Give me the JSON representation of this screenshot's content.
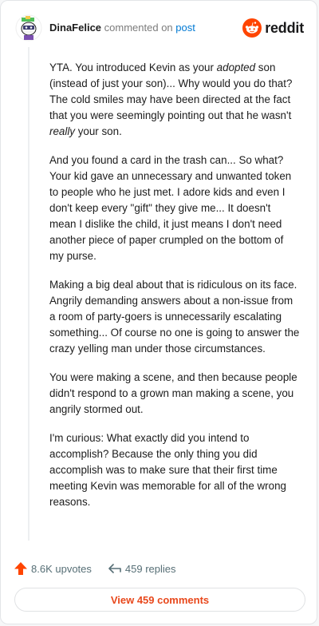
{
  "comment": {
    "username": "DinaFelice",
    "action_text": "commented on",
    "target_link": "post",
    "paragraphs": [
      [
        "YTA. You introduced Kevin as your ",
        {
          "i": "adopted"
        },
        " son (instead of just your son)... Why would you do that? The cold smiles may have been directed at the fact that you were seemingly pointing out that he wasn't ",
        {
          "i": "really"
        },
        " your son."
      ],
      [
        "And you found a card in the trash can... So what? Your kid gave an unnecessary and unwanted token to people who he just met. I adore kids and even I don't keep every \"gift\" they give me... It doesn't mean I dislike the child, it just means I don't need another piece of paper crumpled on the bottom of my purse."
      ],
      [
        "Making a big deal about that is ridiculous on its face. Angrily demanding answers about a non-issue from a room of party-goers is unnecessarily escalating something... Of course no one is going to answer the crazy yelling man under those circumstances."
      ],
      [
        "You were making a scene, and then because people didn't respond to a grown man making a scene, you angrily stormed out."
      ],
      [
        "I'm curious: What exactly did you intend to accomplish? Because the only thing you did accomplish was to make sure that their first time meeting Kevin was memorable for all of the wrong reasons."
      ]
    ]
  },
  "brand": {
    "wordmark": "reddit",
    "icon": "reddit-snoo-icon",
    "color": "#ff4500"
  },
  "footer": {
    "upvotes": "8.6K upvotes",
    "replies": "459 replies",
    "upvote_icon": "upvote-arrow-icon",
    "reply_icon": "reply-arrow-icon",
    "upvote_color": "#ff4500"
  },
  "view_comments": {
    "label": "View 459 comments",
    "color": "#e8481c"
  }
}
